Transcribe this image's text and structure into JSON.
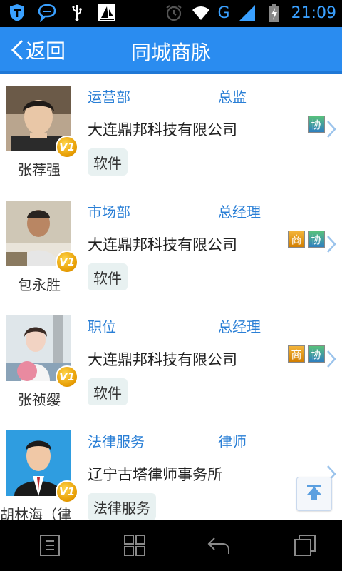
{
  "status_bar": {
    "time": "21:09",
    "network": "G",
    "icons": [
      "shield-t-icon",
      "chat-icon",
      "usb-icon",
      "sailing-app-icon",
      "alarm-icon",
      "wifi-icon",
      "signal-icon",
      "battery-charging-icon"
    ]
  },
  "header": {
    "back_label": "返回",
    "title": "同城商脉"
  },
  "contacts": [
    {
      "name": "张荐强",
      "department": "运营部",
      "title": "总监",
      "company": "大连鼎邦科技有限公司",
      "tag": "软件",
      "badges": [
        "协"
      ],
      "vip": "V1"
    },
    {
      "name": "包永胜",
      "department": "市场部",
      "title": "总经理",
      "company": "大连鼎邦科技有限公司",
      "tag": "软件",
      "badges": [
        "商",
        "协"
      ],
      "vip": "V1"
    },
    {
      "name": "张祯缨",
      "department": "职位",
      "title": "总经理",
      "company": "大连鼎邦科技有限公司",
      "tag": "软件",
      "badges": [
        "商",
        "协"
      ],
      "vip": "V1"
    },
    {
      "name": "胡林海（律",
      "department": "法律服务",
      "title": "律师",
      "company": "辽宁古塔律师事务所",
      "tag": "法律服务",
      "badges": [],
      "vip": "V1"
    }
  ],
  "colors": {
    "header_bg": "#2a8cf0",
    "link_blue": "#2a7fd6",
    "status_icon": "#3aa0ff"
  }
}
